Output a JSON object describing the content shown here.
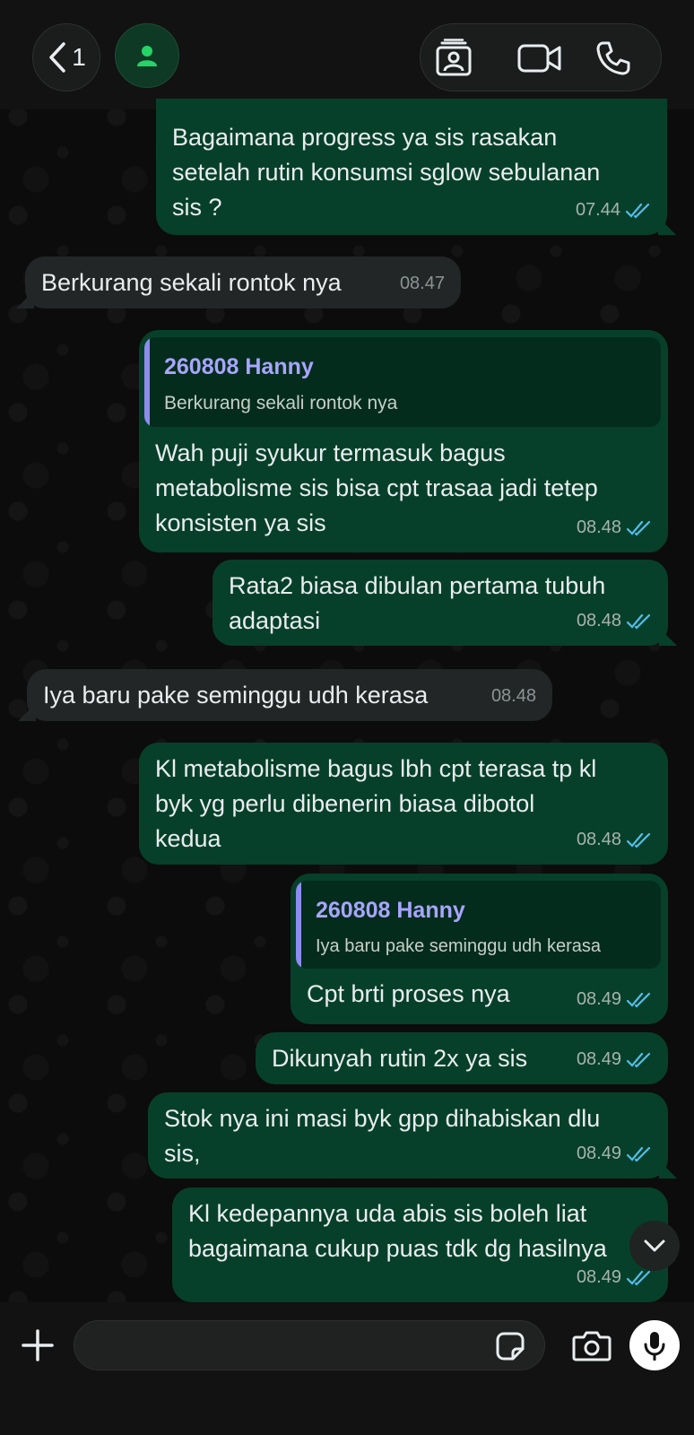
{
  "header": {
    "unread_count": "1"
  },
  "messages": [
    {
      "text": "Bagaimana progress ya sis rasakan\nsetelah rutin konsumsi sglow sebulanan\nsis ?",
      "time": "07.44"
    },
    {
      "text": "Berkurang sekali rontok nya",
      "time": "08.47"
    },
    {
      "quote_name": "260808 Hanny",
      "quote_text": "Berkurang sekali rontok nya",
      "text": "Wah puji syukur termasuk bagus\nmetabolisme sis bisa cpt trasaa jadi tetep\nkonsisten ya sis",
      "time": "08.48"
    },
    {
      "text": "Rata2 biasa dibulan pertama tubuh\nadaptasi",
      "time": "08.48"
    },
    {
      "text": "Iya baru pake seminggu udh kerasa",
      "time": "08.48"
    },
    {
      "text": "Kl metabolisme bagus lbh cpt terasa tp kl\nbyk yg perlu dibenerin biasa dibotol\nkedua",
      "time": "08.48"
    },
    {
      "quote_name": "260808 Hanny",
      "quote_text": "Iya baru pake seminggu udh kerasa",
      "text": "Cpt brti proses nya",
      "time": "08.49"
    },
    {
      "text": "Dikunyah rutin 2x ya sis",
      "time": "08.49"
    },
    {
      "text": "Stok nya ini masi byk gpp dihabiskan dlu\nsis,",
      "time": "08.49"
    },
    {
      "text": "Kl kedepannya uda abis sis boleh liat\nbagaimana cukup puas tdk dg hasilnya",
      "time": "08.49"
    }
  ],
  "composer": {
    "value": ""
  },
  "colors": {
    "outgoing_bubble": "#07402a",
    "incoming_bubble": "#232626",
    "read_ticks": "#53bdeb",
    "quote_accent": "#8e8cf2",
    "avatar_green": "#25d366"
  },
  "icons": [
    "chevron-left-icon",
    "person-icon",
    "contact-card-icon",
    "video-call-icon",
    "phone-icon",
    "double-check-icon",
    "chevron-down-icon",
    "plus-icon",
    "sticker-icon",
    "camera-icon",
    "microphone-icon"
  ]
}
